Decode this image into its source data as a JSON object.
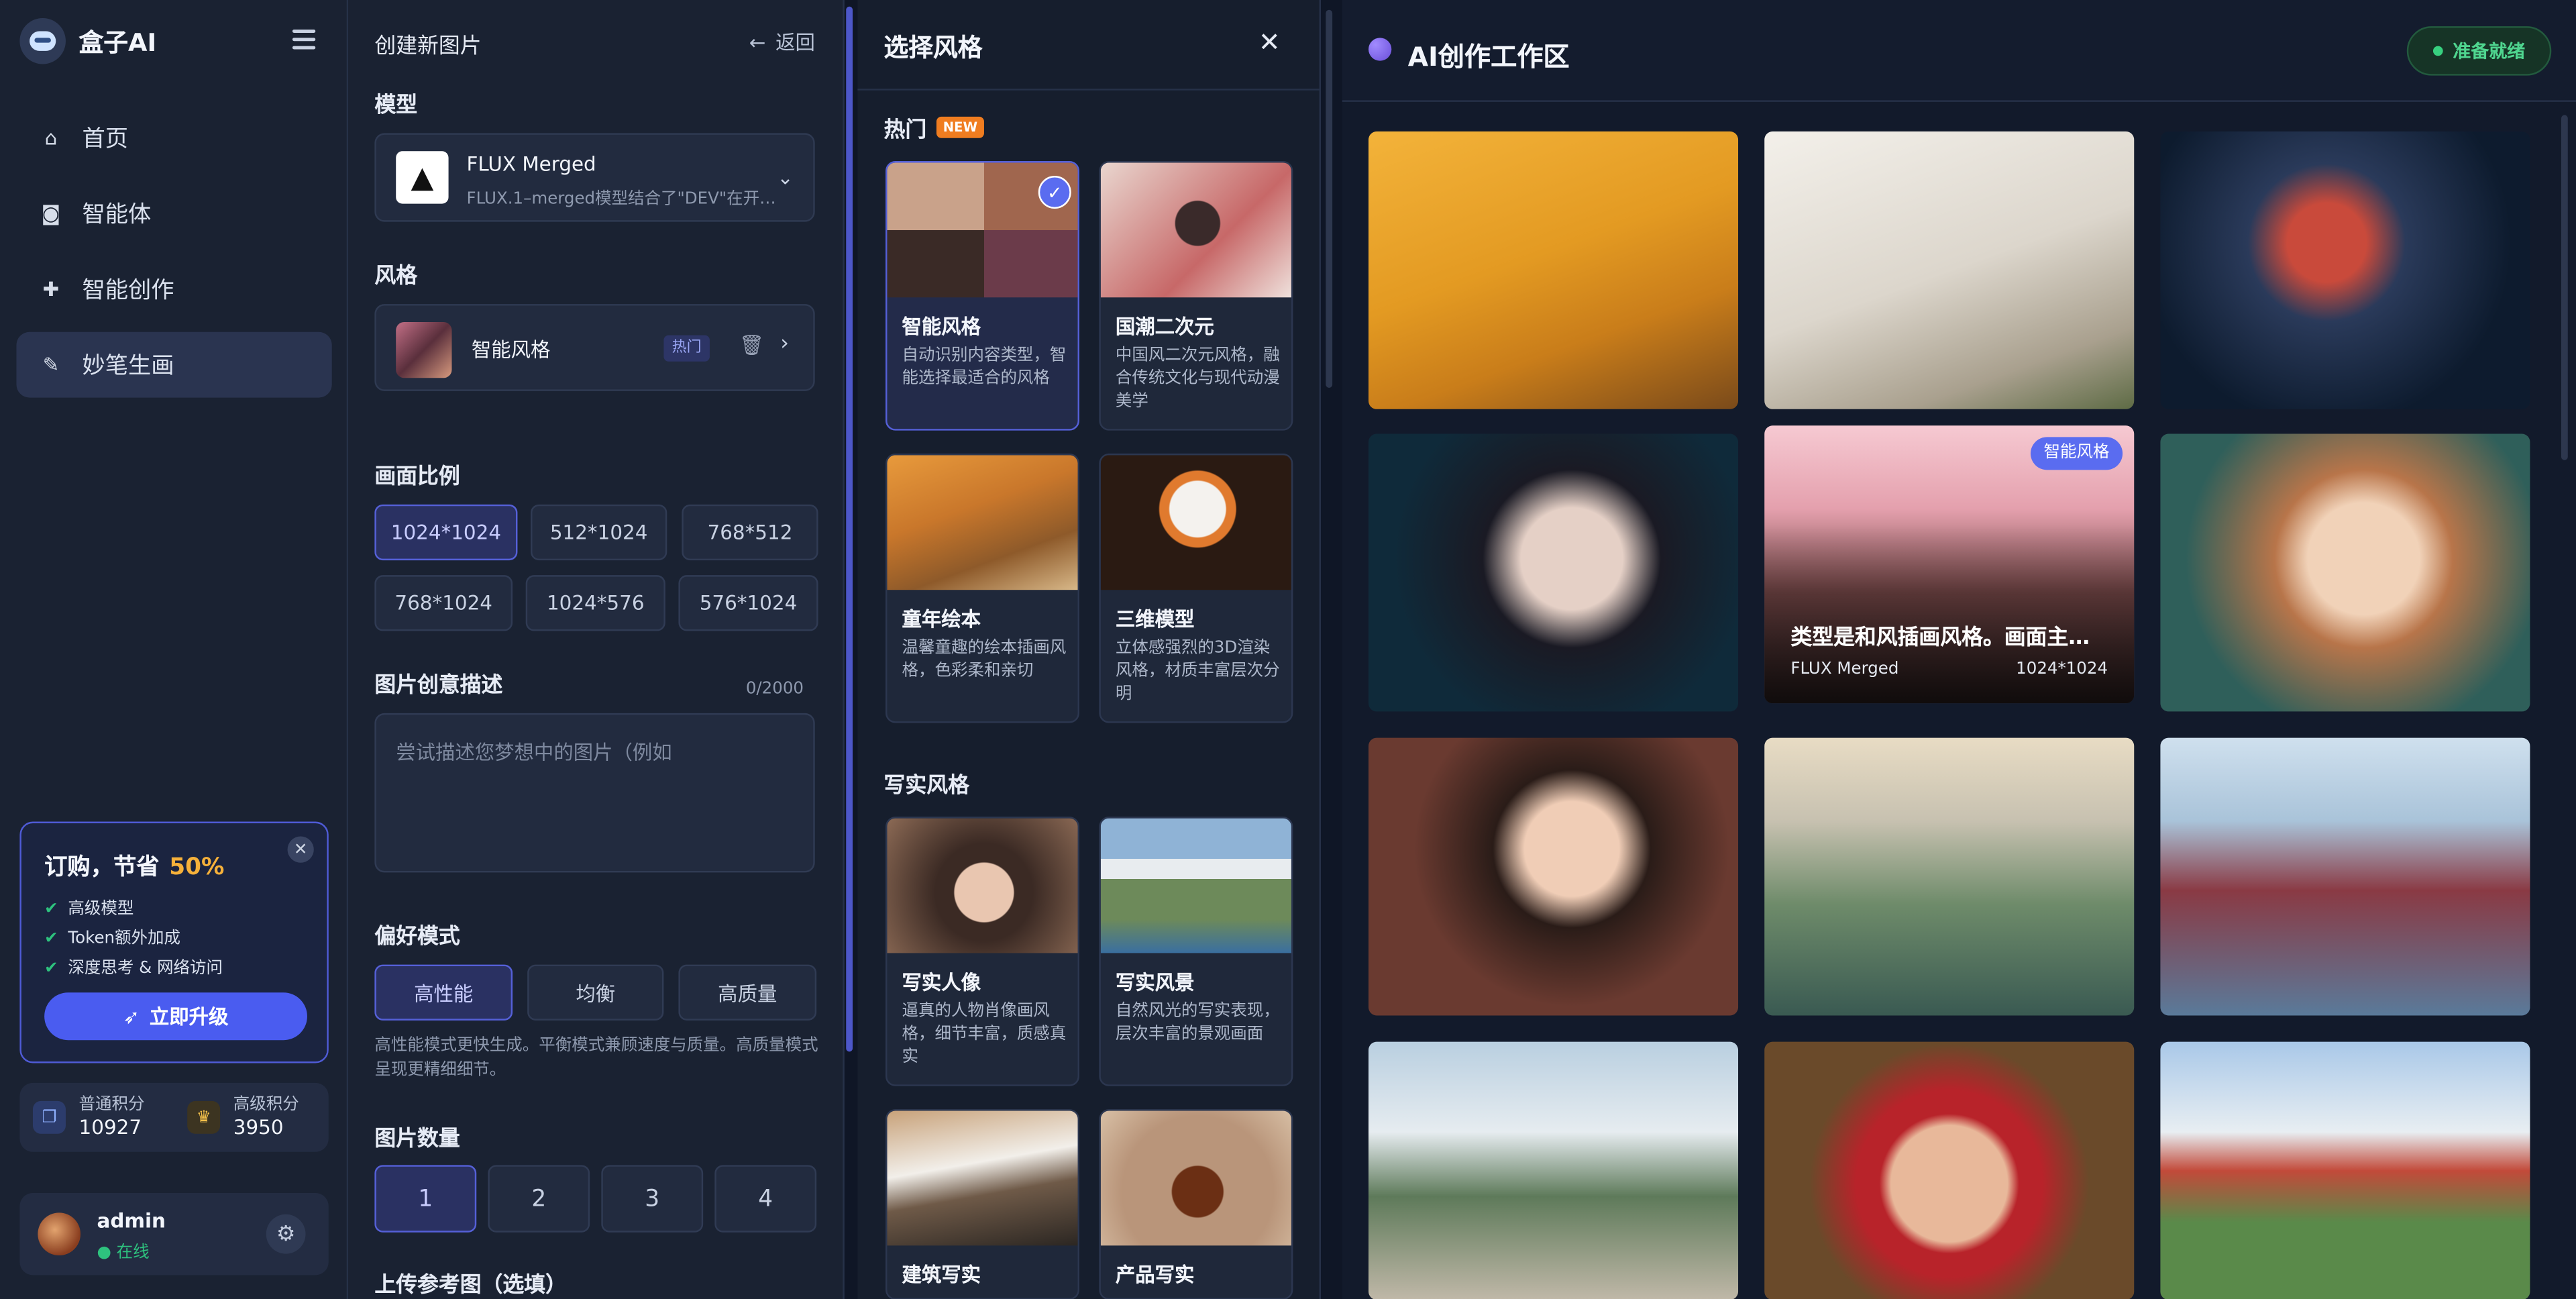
{
  "brand": {
    "name": "盒子AI"
  },
  "sidebar": {
    "items": [
      {
        "label": "首页",
        "icon": "home-icon"
      },
      {
        "label": "智能体",
        "icon": "robot-icon"
      },
      {
        "label": "智能创作",
        "icon": "puzzle-icon"
      },
      {
        "label": "妙笔生画",
        "icon": "brush-icon"
      }
    ],
    "active": "妙笔生画",
    "promo": {
      "title": "订购，节省",
      "percent": "50%",
      "features": [
        "高级模型",
        "Token额外加成",
        "深度思考 & 网络访问"
      ],
      "cta": "立即升级"
    },
    "points": {
      "normal_label": "普通积分",
      "normal_value": "10927",
      "premium_label": "高级积分",
      "premium_value": "3950"
    },
    "user": {
      "name": "admin",
      "status": "● 在线"
    }
  },
  "form": {
    "header": "创建新图片",
    "back": "返回",
    "model_label": "模型",
    "model_name": "FLUX Merged",
    "model_desc": "FLUX.1–merged模型结合了\"DEV\"在开发…",
    "style_label": "风格",
    "style_name": "智能风格",
    "style_badge": "热门",
    "ratio_label": "画面比例",
    "ratios": [
      "1024*1024",
      "512*1024",
      "768*512",
      "768*1024",
      "1024*576",
      "576*1024"
    ],
    "ratio_selected": "1024*1024",
    "desc_label": "图片创意描述",
    "desc_count": "0/2000",
    "desc_placeholder": "尝试描述您梦想中的图片（例如",
    "pref_label": "偏好模式",
    "prefs": [
      "高性能",
      "均衡",
      "高质量"
    ],
    "pref_selected": "高性能",
    "pref_note": "高性能模式更快生成。平衡模式兼顾速度与质量。高质量模式呈现更精细细节。",
    "count_label": "图片数量",
    "counts": [
      "1",
      "2",
      "3",
      "4"
    ],
    "count_selected": "1",
    "upload_label": "上传参考图（选填）"
  },
  "chooser": {
    "title": "选择风格",
    "hot_label": "热门",
    "new_badge": "NEW",
    "realistic_label": "写实风格",
    "hot_cards": [
      {
        "title": "智能风格",
        "desc": "自动识别内容类型，智能选择最适合的风格",
        "selected": true
      },
      {
        "title": "国潮二次元",
        "desc": "中国风二次元风格，融合传统文化与现代动漫美学"
      },
      {
        "title": "童年绘本",
        "desc": "温馨童趣的绘本插画风格，色彩柔和亲切"
      },
      {
        "title": "三维模型",
        "desc": "立体感强烈的3D渲染风格，材质丰富层次分明"
      }
    ],
    "real_cards": [
      {
        "title": "写实人像",
        "desc": "逼真的人物肖像画风格，细节丰富，质感真实"
      },
      {
        "title": "写实风景",
        "desc": "自然风光的写实表现，层次丰富的景观画面"
      },
      {
        "title": "建筑写实",
        "desc": ""
      },
      {
        "title": "产品写实",
        "desc": ""
      }
    ]
  },
  "workspace": {
    "title": "AI创作工作区",
    "status": "准备就绪",
    "overlay": {
      "badge": "智能风格",
      "title": "类型是和风插画风格。画面主…",
      "model": "FLUX Merged",
      "size": "1024*1024"
    }
  }
}
